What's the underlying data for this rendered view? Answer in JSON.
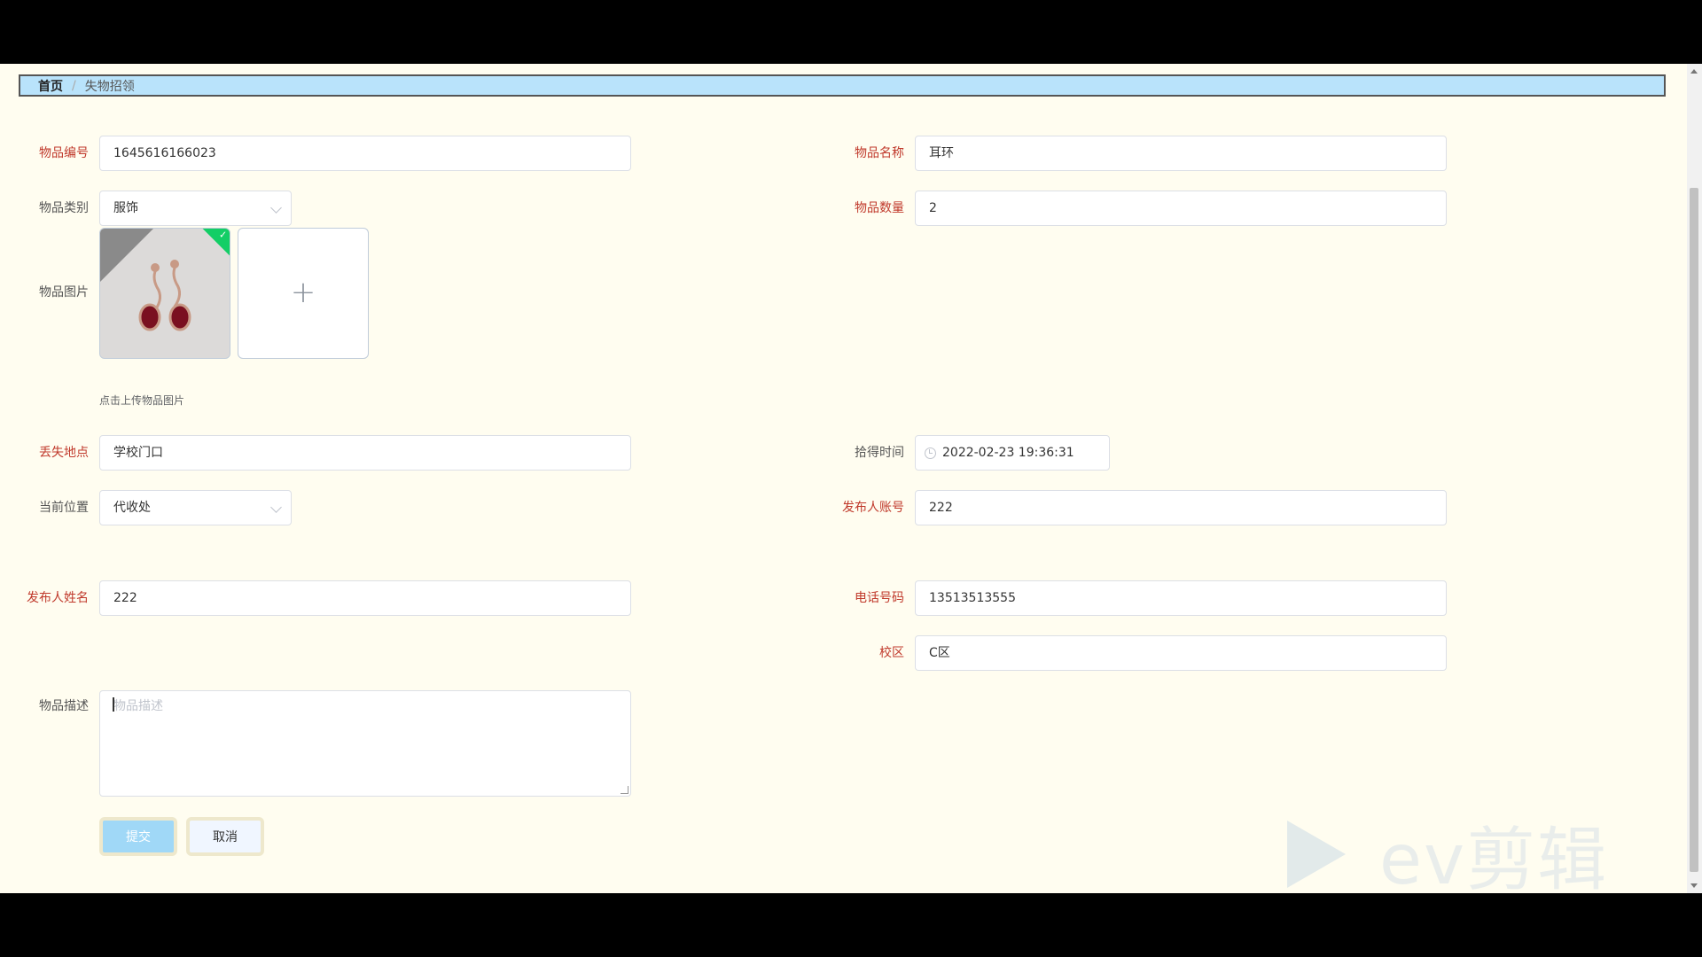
{
  "breadcrumb": {
    "home": "首页",
    "separator": "/",
    "current": "失物招领"
  },
  "form": {
    "item_no": {
      "label": "物品编号",
      "value": "1645616166023"
    },
    "item_name": {
      "label": "物品名称",
      "value": "耳环"
    },
    "category": {
      "label": "物品类别",
      "value": "服饰"
    },
    "quantity": {
      "label": "物品数量",
      "value": "2"
    },
    "image": {
      "label": "物品图片",
      "tip": "点击上传物品图片",
      "upload_icon": "plus-icon"
    },
    "lost_place": {
      "label": "丢失地点",
      "value": "学校门口"
    },
    "found_time": {
      "label": "拾得时间",
      "value": "2022-02-23 19:36:31"
    },
    "current_location": {
      "label": "当前位置",
      "value": "代收处"
    },
    "publisher_account": {
      "label": "发布人账号",
      "value": "222"
    },
    "publisher_name": {
      "label": "发布人姓名",
      "value": "222"
    },
    "phone": {
      "label": "电话号码",
      "value": "13513513555"
    },
    "campus": {
      "label": "校区",
      "value": "C区"
    },
    "description": {
      "label": "物品描述",
      "placeholder": "物品描述"
    }
  },
  "buttons": {
    "submit": "提交",
    "cancel": "取消"
  },
  "watermark": {
    "text": "ev剪辑"
  },
  "colors": {
    "required_label": "#c0392b",
    "page_bg": "#fffdf0",
    "breadcrumb_bg": "#b9e3fb",
    "success": "#13ce66"
  }
}
